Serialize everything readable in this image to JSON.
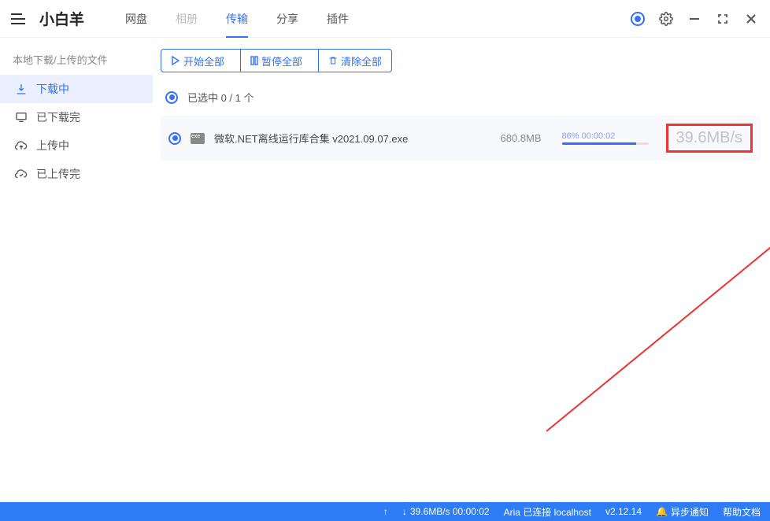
{
  "app": {
    "title": "小白羊"
  },
  "tabs": [
    {
      "label": "网盘"
    },
    {
      "label": "相册"
    },
    {
      "label": "传输"
    },
    {
      "label": "分享"
    },
    {
      "label": "插件"
    }
  ],
  "sidebar": {
    "header": "本地下载/上传的文件",
    "items": [
      {
        "label": "下载中"
      },
      {
        "label": "已下载完"
      },
      {
        "label": "上传中"
      },
      {
        "label": "已上传完"
      }
    ]
  },
  "toolbar": {
    "start_all": "开始全部",
    "pause_all": "暂停全部",
    "clear_all": "清除全部"
  },
  "selection": {
    "label": "已选中 0 / 1 个"
  },
  "file": {
    "name": "微软.NET离线运行库合集 v2021.09.07.exe",
    "size": "680.8MB",
    "progress_text": "86% 00:00:02",
    "speed": "39.6MB/s"
  },
  "status": {
    "upload": "↑",
    "download": "39.6MB/s 00:00:02",
    "aria": "Aria 已连接 localhost",
    "version": "v2.12.14",
    "notify": "异步通知",
    "help": "帮助文档"
  }
}
